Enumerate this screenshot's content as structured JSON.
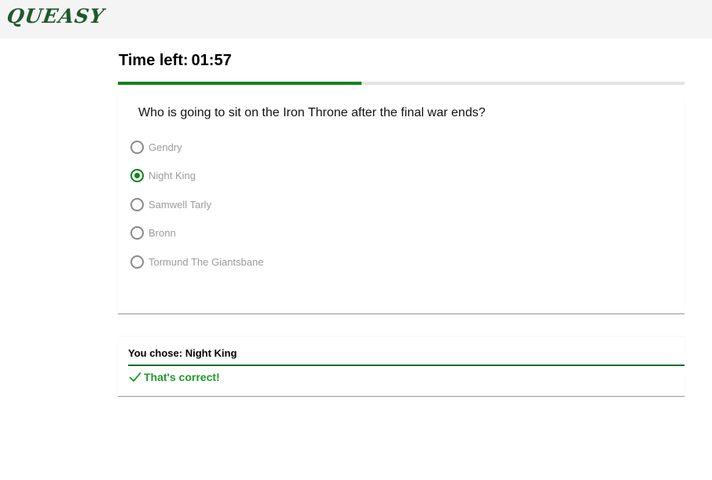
{
  "header": {
    "logo": "QUEASY"
  },
  "timer": {
    "label": "Time left:",
    "value": "01:57",
    "progress_percent": 43
  },
  "question": {
    "text": "Who is going to sit on the Iron Throne after the final war ends?",
    "options": [
      {
        "label": "Gendry",
        "selected": false
      },
      {
        "label": "Night King",
        "selected": true
      },
      {
        "label": "Samwell Tarly",
        "selected": false
      },
      {
        "label": "Bronn",
        "selected": false
      },
      {
        "label": "Tormund The Giantsbane",
        "selected": false
      }
    ]
  },
  "result": {
    "chosen_text": "You chose: Night King",
    "verdict": "That's correct!",
    "verdict_icon": "checkmark-icon"
  },
  "colors": {
    "accent": "#15821d",
    "success": "#1f9a2a",
    "logo": "#1e5a2c"
  }
}
